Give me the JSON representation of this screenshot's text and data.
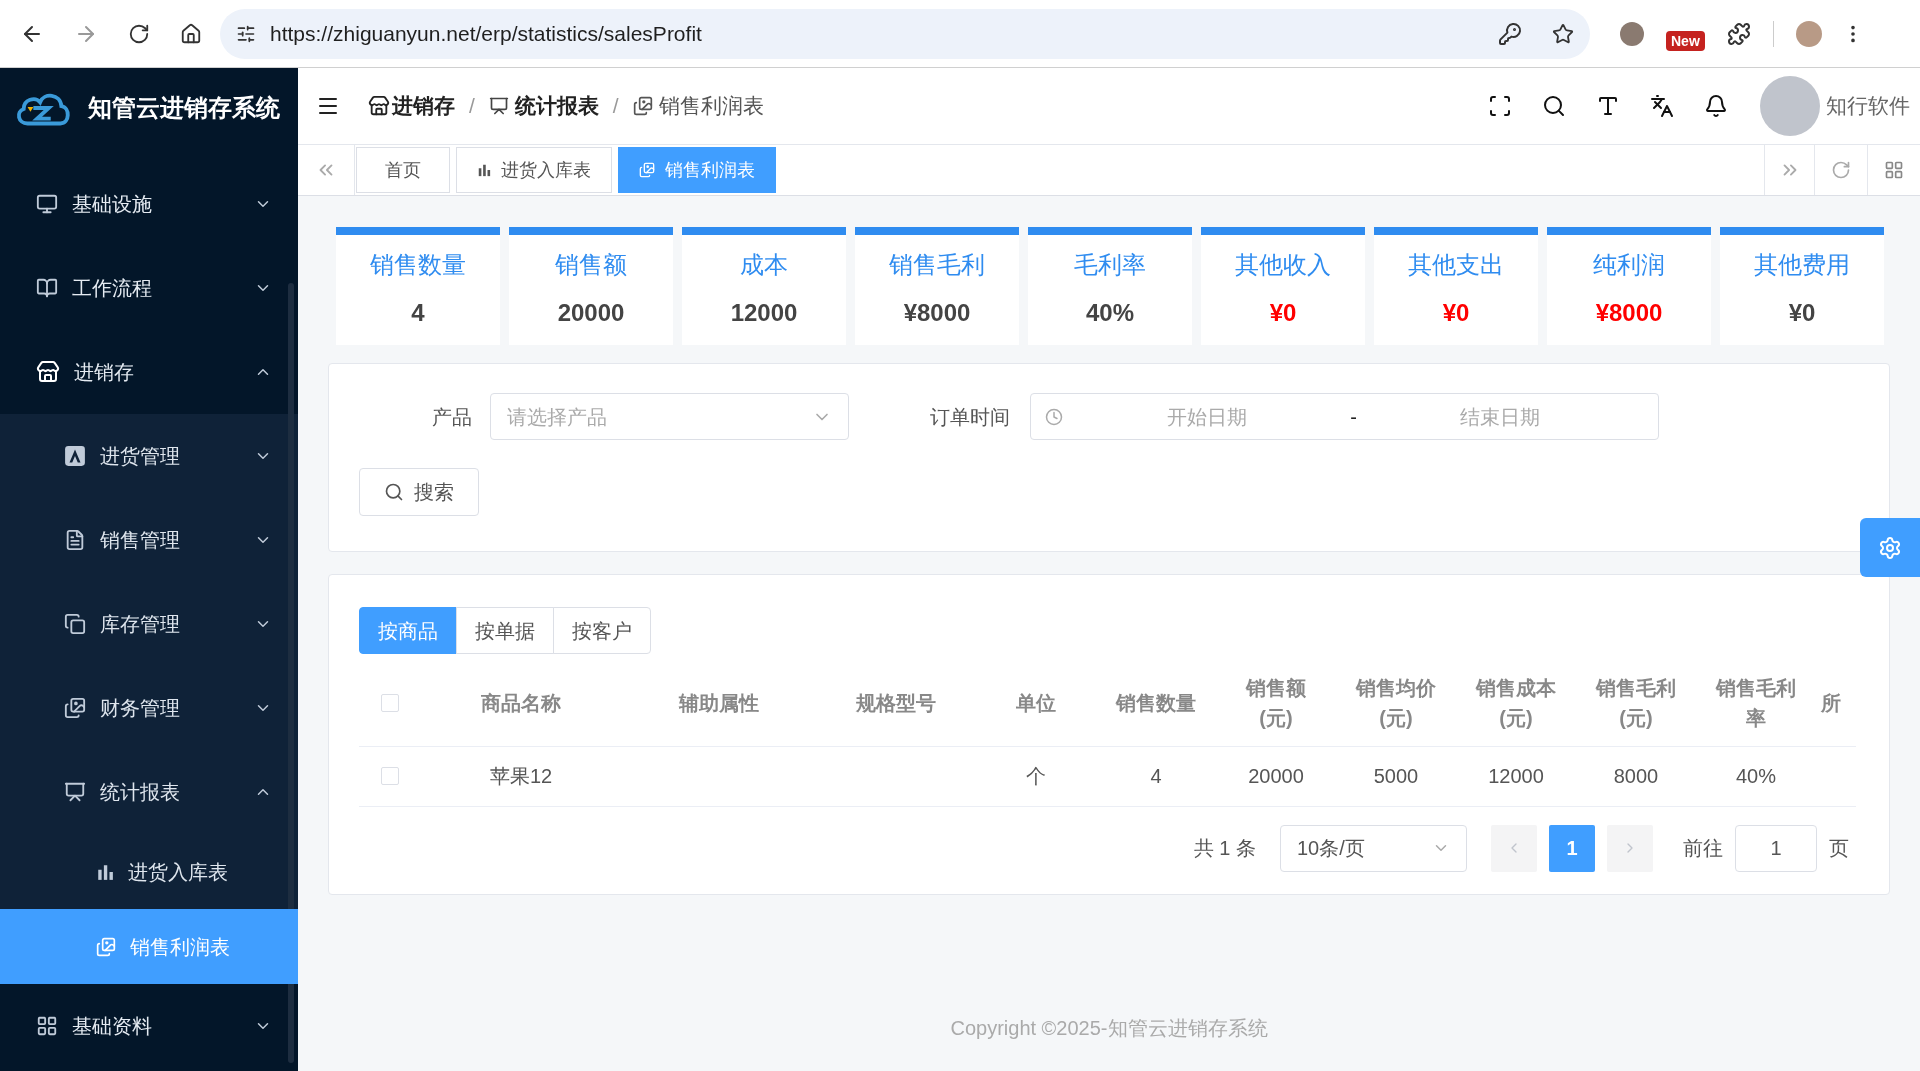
{
  "browser": {
    "url": "https://zhiguanyun.net/erp/statistics/salesProfit",
    "new_badge": "New"
  },
  "sidebar": {
    "brand": "知管云进销存系统",
    "items": [
      {
        "label": "基础设施",
        "expanded": false,
        "selected": false
      },
      {
        "label": "工作流程",
        "expanded": false,
        "selected": false
      },
      {
        "label": "进销存",
        "expanded": true,
        "selected": false,
        "children": [
          {
            "label": "进货管理",
            "expanded": false,
            "selected": false
          },
          {
            "label": "销售管理",
            "expanded": false,
            "selected": false
          },
          {
            "label": "库存管理",
            "expanded": false,
            "selected": false
          },
          {
            "label": "财务管理",
            "expanded": false,
            "selected": false
          },
          {
            "label": "统计报表",
            "expanded": true,
            "selected": false,
            "children": [
              {
                "label": "进货入库表",
                "selected": false
              },
              {
                "label": "销售利润表",
                "selected": true
              }
            ]
          }
        ]
      },
      {
        "label": "基础资料",
        "expanded": false,
        "selected": false
      }
    ]
  },
  "header": {
    "breadcrumb": [
      "进销存",
      "统计报表",
      "销售利润表"
    ],
    "separator": "/",
    "user": "知行软件"
  },
  "tabs": [
    {
      "label": "首页",
      "selected": false
    },
    {
      "label": "进货入库表",
      "selected": false
    },
    {
      "label": "销售利润表",
      "selected": true
    }
  ],
  "stats": [
    {
      "label": "销售数量",
      "value": "4",
      "color": "#444444"
    },
    {
      "label": "销售额",
      "value": "20000",
      "color": "#444444"
    },
    {
      "label": "成本",
      "value": "12000",
      "color": "#444444"
    },
    {
      "label": "销售毛利",
      "value": "¥8000",
      "color": "#444444"
    },
    {
      "label": "毛利率",
      "value": "40%",
      "color": "#444444"
    },
    {
      "label": "其他收入",
      "value": "¥0",
      "color": "#ff0000"
    },
    {
      "label": "其他支出",
      "value": "¥0",
      "color": "#ff0000"
    },
    {
      "label": "纯利润",
      "value": "¥8000",
      "color": "#ff0000"
    },
    {
      "label": "其他费用",
      "value": "¥0",
      "color": "#444444"
    }
  ],
  "filter": {
    "product": {
      "label": "产品",
      "placeholder": "请选择产品"
    },
    "order_time": {
      "label": "订单时间",
      "start_placeholder": "开始日期",
      "separator": "-",
      "end_placeholder": "结束日期"
    },
    "search_button": "搜索"
  },
  "view_tabs": [
    {
      "label": "按商品",
      "selected": true
    },
    {
      "label": "按单据",
      "selected": false
    },
    {
      "label": "按客户",
      "selected": false
    }
  ],
  "table": {
    "header_checked": false,
    "columns": [
      "商品名称",
      "辅助属性",
      "规格型号",
      "单位",
      "销售数量",
      "销售额(元)",
      "销售均价(元)",
      "销售成本(元)",
      "销售毛利(元)",
      "销售毛利率",
      "所"
    ],
    "rows": [
      {
        "checked": false,
        "cells": [
          "苹果12",
          "",
          "",
          "个",
          "4",
          "20000",
          "5000",
          "12000",
          "8000",
          "40%",
          ""
        ]
      }
    ]
  },
  "pagination": {
    "total": "共 1 条",
    "page_size": "10条/页",
    "pages": [
      {
        "label": "1",
        "selected": true
      }
    ],
    "goto_label": "前往",
    "goto_value": "1",
    "suffix": "页"
  },
  "footer": "Copyright ©2025-知管云进销存系统"
}
